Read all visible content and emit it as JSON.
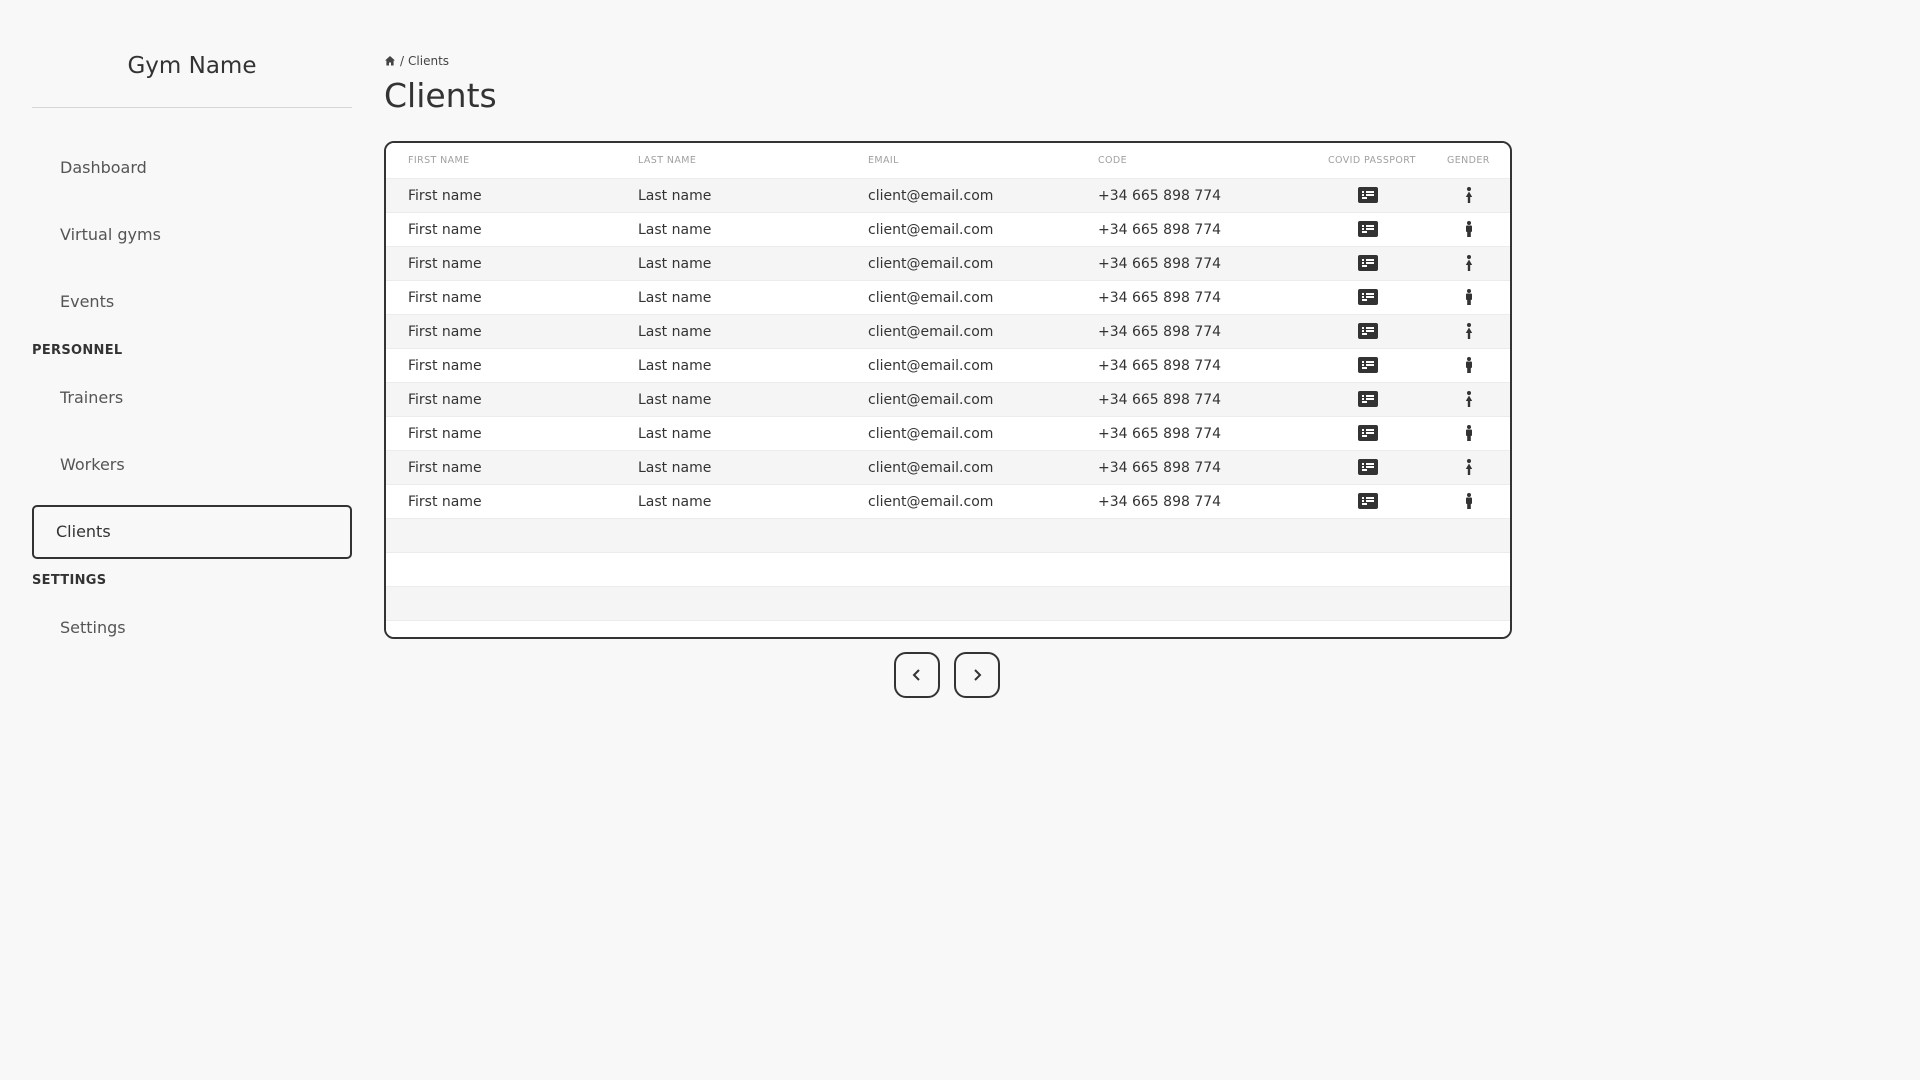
{
  "sidebar": {
    "brand": "Gym Name",
    "items": [
      {
        "label": "Dashboard"
      },
      {
        "label": "Virtual gyms"
      },
      {
        "label": "Events"
      },
      {
        "label": "Trainers"
      },
      {
        "label": "Workers"
      },
      {
        "label": "Clients",
        "active": true
      },
      {
        "label": "Settings"
      }
    ],
    "sections": [
      {
        "label": "PERSONNEL"
      },
      {
        "label": "SETTINGS"
      }
    ]
  },
  "breadcrumb": {
    "home_icon": "home-icon",
    "separator": "/",
    "current": "Clients"
  },
  "page": {
    "title": "Clients"
  },
  "table": {
    "columns": [
      "FIRST NAME",
      "LAST NAME",
      "EMAIL",
      "CODE",
      "COVID PASSPORT",
      "GENDER"
    ],
    "rows": [
      {
        "first": "First name",
        "last": "Last name",
        "email": "client@email.com",
        "code": "+34 665 898 774",
        "covid_icon": "id-card-icon",
        "gender_icon": "female-icon"
      },
      {
        "first": "First name",
        "last": "Last name",
        "email": "client@email.com",
        "code": "+34 665 898 774",
        "covid_icon": "id-card-icon",
        "gender_icon": "male-icon"
      },
      {
        "first": "First name",
        "last": "Last name",
        "email": "client@email.com",
        "code": "+34 665 898 774",
        "covid_icon": "id-card-icon",
        "gender_icon": "female-icon"
      },
      {
        "first": "First name",
        "last": "Last name",
        "email": "client@email.com",
        "code": "+34 665 898 774",
        "covid_icon": "id-card-icon",
        "gender_icon": "male-icon"
      },
      {
        "first": "First name",
        "last": "Last name",
        "email": "client@email.com",
        "code": "+34 665 898 774",
        "covid_icon": "id-card-icon",
        "gender_icon": "female-icon"
      },
      {
        "first": "First name",
        "last": "Last name",
        "email": "client@email.com",
        "code": "+34 665 898 774",
        "covid_icon": "id-card-icon",
        "gender_icon": "male-icon"
      },
      {
        "first": "First name",
        "last": "Last name",
        "email": "client@email.com",
        "code": "+34 665 898 774",
        "covid_icon": "id-card-icon",
        "gender_icon": "female-icon"
      },
      {
        "first": "First name",
        "last": "Last name",
        "email": "client@email.com",
        "code": "+34 665 898 774",
        "covid_icon": "id-card-icon",
        "gender_icon": "male-icon"
      },
      {
        "first": "First name",
        "last": "Last name",
        "email": "client@email.com",
        "code": "+34 665 898 774",
        "covid_icon": "id-card-icon",
        "gender_icon": "female-icon"
      },
      {
        "first": "First name",
        "last": "Last name",
        "email": "client@email.com",
        "code": "+34 665 898 774",
        "covid_icon": "id-card-icon",
        "gender_icon": "male-icon"
      }
    ],
    "empty_rows": 4
  },
  "pagination": {
    "prev_icon": "chevron-left-icon",
    "next_icon": "chevron-right-icon"
  },
  "colors": {
    "background": "#f8f8f8",
    "text": "#333333",
    "border": "#333333",
    "row_alt": "#f5f5f5",
    "header_text": "#a0a0a0"
  }
}
